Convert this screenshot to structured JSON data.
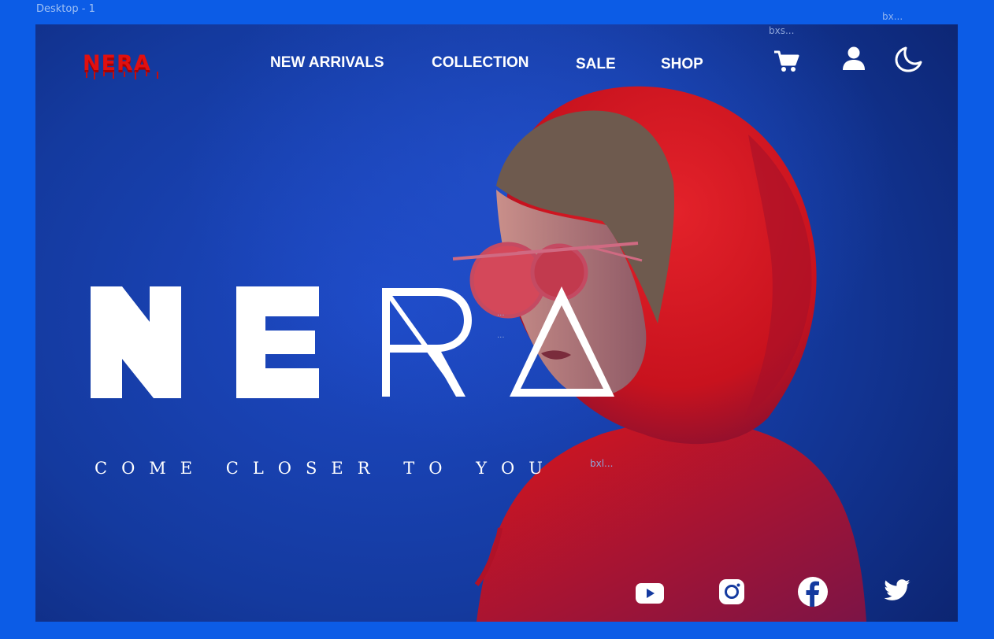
{
  "canvas": {
    "frame_label": "Desktop - 1",
    "layer_label_top_right": "bx...",
    "layer_label_cart": "bxs...",
    "layer_label_tagline": "bxl...",
    "layer_dots_1": "...",
    "layer_dots_2": "..."
  },
  "brand": {
    "logo_text": "NERA",
    "hero_word": "NERA",
    "tagline": "COME CLOSER TO YOU"
  },
  "nav": {
    "items": [
      "NEW ARRIVALS",
      "COLLECTION",
      "SALE",
      "SHOP"
    ]
  },
  "header_icons": [
    "cart-icon",
    "user-icon",
    "moon-icon"
  ],
  "social_icons": [
    "youtube-icon",
    "instagram-icon",
    "facebook-icon",
    "twitter-icon"
  ],
  "colors": {
    "page_background": "#0c5ce6",
    "hero_blue": "#1d49c4",
    "logo_red": "#e01010",
    "hoodie_red": "#d8151c",
    "text_white": "#ffffff"
  }
}
